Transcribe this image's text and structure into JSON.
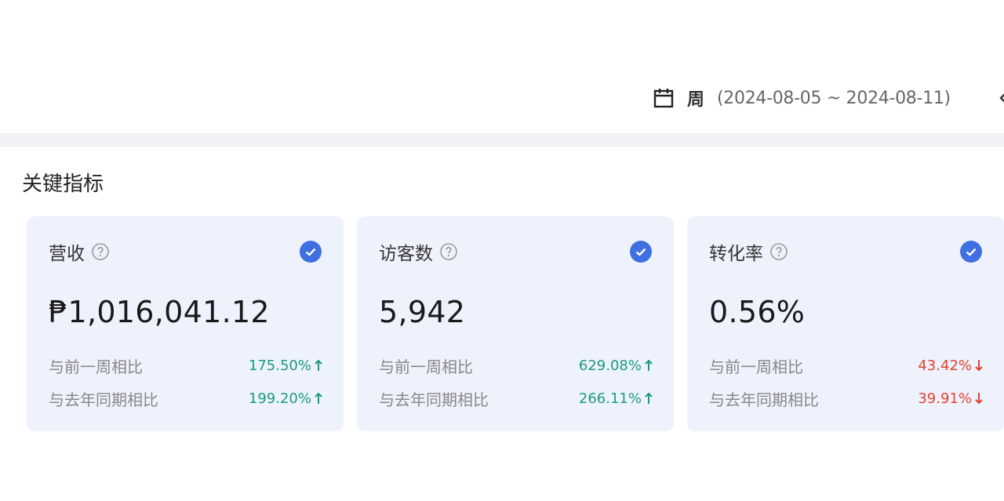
{
  "period": {
    "type": "周",
    "range": "(2024-08-05 ~ 2024-08-11)",
    "icon": "calendar-icon"
  },
  "section": {
    "title": "关键指标"
  },
  "colors": {
    "accent": "#3f6fe0",
    "up": "#1b9a81",
    "down": "#e1412b",
    "card_bg": "#eef2fd"
  },
  "cards": [
    {
      "title": "营收",
      "value": "₱1,016,041.12",
      "checked": true,
      "comparisons": [
        {
          "label": "与前一周相比",
          "value": "175.50%",
          "direction": "up"
        },
        {
          "label": "与去年同期相比",
          "value": "199.20%",
          "direction": "up"
        }
      ]
    },
    {
      "title": "访客数",
      "value": "5,942",
      "checked": true,
      "comparisons": [
        {
          "label": "与前一周相比",
          "value": "629.08%",
          "direction": "up"
        },
        {
          "label": "与去年同期相比",
          "value": "266.11%",
          "direction": "up"
        }
      ]
    },
    {
      "title": "转化率",
      "value": "0.56%",
      "checked": true,
      "comparisons": [
        {
          "label": "与前一周相比",
          "value": "43.42%",
          "direction": "down"
        },
        {
          "label": "与去年同期相比",
          "value": "39.91%",
          "direction": "down"
        }
      ]
    }
  ]
}
